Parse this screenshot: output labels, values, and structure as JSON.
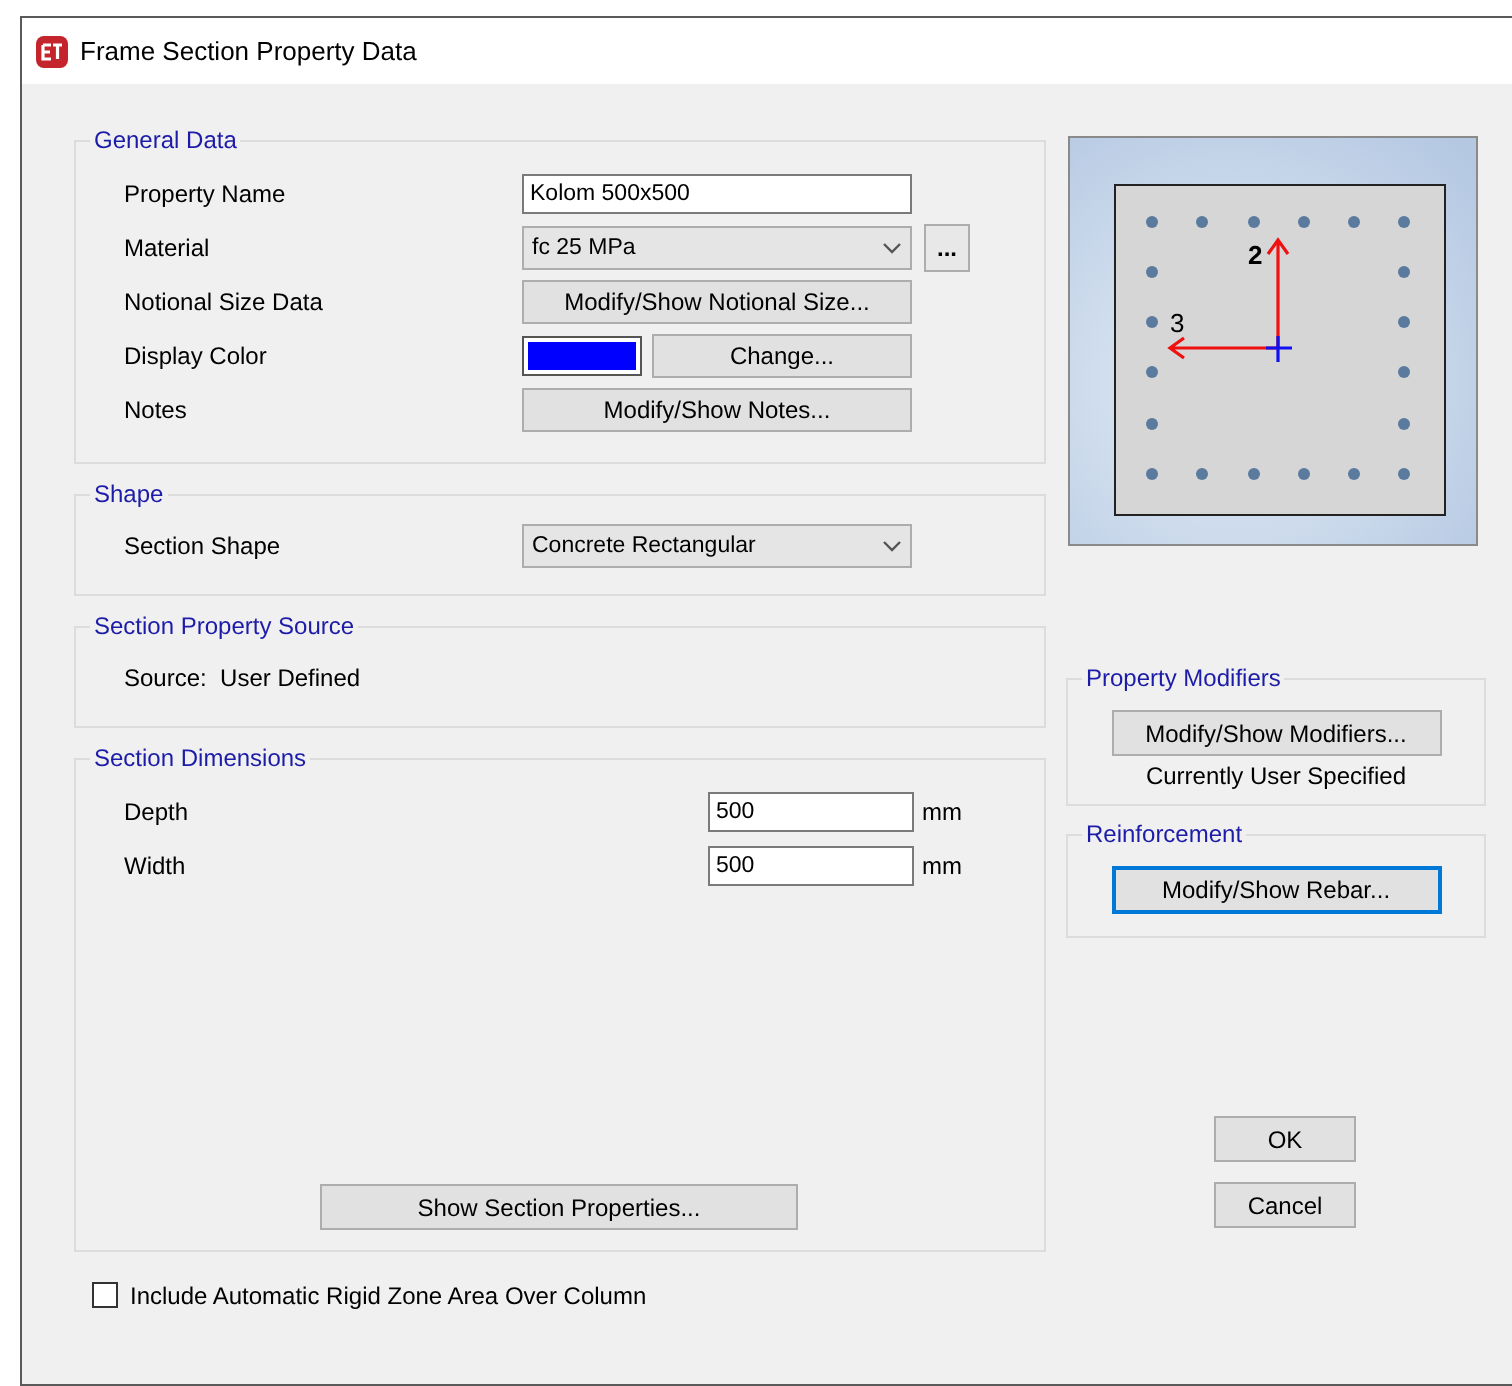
{
  "window": {
    "title": "Frame Section Property Data"
  },
  "general_data": {
    "title": "General Data",
    "rows": [
      {
        "kind": "text",
        "label": "Property Name",
        "value": "Kolom 500x500"
      },
      {
        "kind": "dropdown",
        "label": "Material",
        "value": "fc 25 MPa",
        "button": "..."
      },
      {
        "kind": "button",
        "label": "Notional Size Data",
        "button": "Modify/Show Notional Size..."
      },
      {
        "kind": "color",
        "label": "Display Color",
        "color": "#0000ff",
        "button": "Change..."
      },
      {
        "kind": "button",
        "label": "Notes",
        "button": "Modify/Show Notes..."
      }
    ]
  },
  "shape": {
    "title": "Shape",
    "label": "Section Shape",
    "value": "Concrete Rectangular"
  },
  "section_property_source": {
    "title": "Section Property Source",
    "text": "Source:  User Defined"
  },
  "section_dimensions": {
    "title": "Section Dimensions",
    "rows": [
      {
        "label": "Depth",
        "value": "500",
        "unit": "mm"
      },
      {
        "label": "Width",
        "value": "500",
        "unit": "mm"
      }
    ],
    "button": "Show Section Properties..."
  },
  "rigid_zone": {
    "label": "Include Automatic Rigid Zone Area Over Column",
    "checked": false
  },
  "preview": {
    "axis_labels": [
      "2",
      "3"
    ]
  },
  "property_modifiers": {
    "title": "Property Modifiers",
    "button": "Modify/Show Modifiers...",
    "status": "Currently User Specified"
  },
  "reinforcement": {
    "title": "Reinforcement",
    "button": "Modify/Show Rebar...",
    "focused": true
  },
  "buttons": [
    "OK",
    "Cancel"
  ]
}
